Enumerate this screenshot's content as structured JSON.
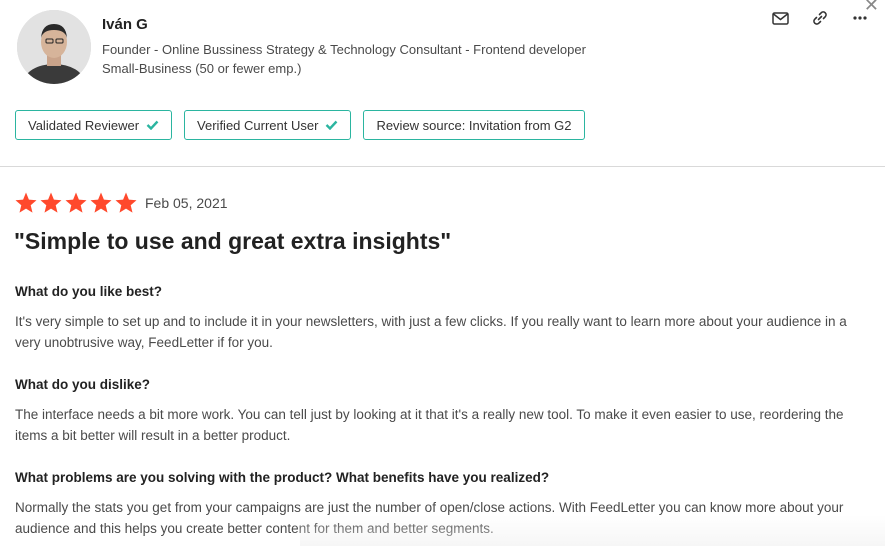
{
  "reviewer": {
    "name": "Iván G",
    "title": "Founder - Online Bussiness Strategy & Technology Consultant - Frontend developer",
    "segment": "Small-Business (50 or fewer emp.)"
  },
  "actions": {
    "icons": [
      "mail-icon",
      "link-icon",
      "more-icon",
      "close-icon"
    ],
    "close_glyph": "✕"
  },
  "badges": [
    {
      "label": "Validated Reviewer",
      "check": true
    },
    {
      "label": "Verified Current User",
      "check": true
    },
    {
      "label": "Review source: Invitation from G2",
      "check": false
    }
  ],
  "review": {
    "rating": 5,
    "rating_max": 5,
    "date": "Feb 05, 2021",
    "title": "\"Simple to use and great extra insights\"",
    "sections": [
      {
        "question": "What do you like best?",
        "answer": "It's very simple to set up and to include it in your newsletters, with just a few clicks. If you really want to learn more about your audience in a very unobtrusive way, FeedLetter if for you."
      },
      {
        "question": "What do you dislike?",
        "answer": "The interface needs a bit more work. You can tell just by looking at it that it's a really new tool. To make it even easier to use, reordering the items a bit better will result in a better product."
      },
      {
        "question": "What problems are you solving with the product? What benefits have you realized?",
        "answer": "Normally the stats you get from your campaigns are just the number of open/close actions. With FeedLetter you can know more about your audience and this helps you create better content for them and better segments."
      }
    ]
  },
  "colors": {
    "star": "#ff492c",
    "badge_border": "#2bb5a0",
    "check": "#2bb5a0"
  }
}
